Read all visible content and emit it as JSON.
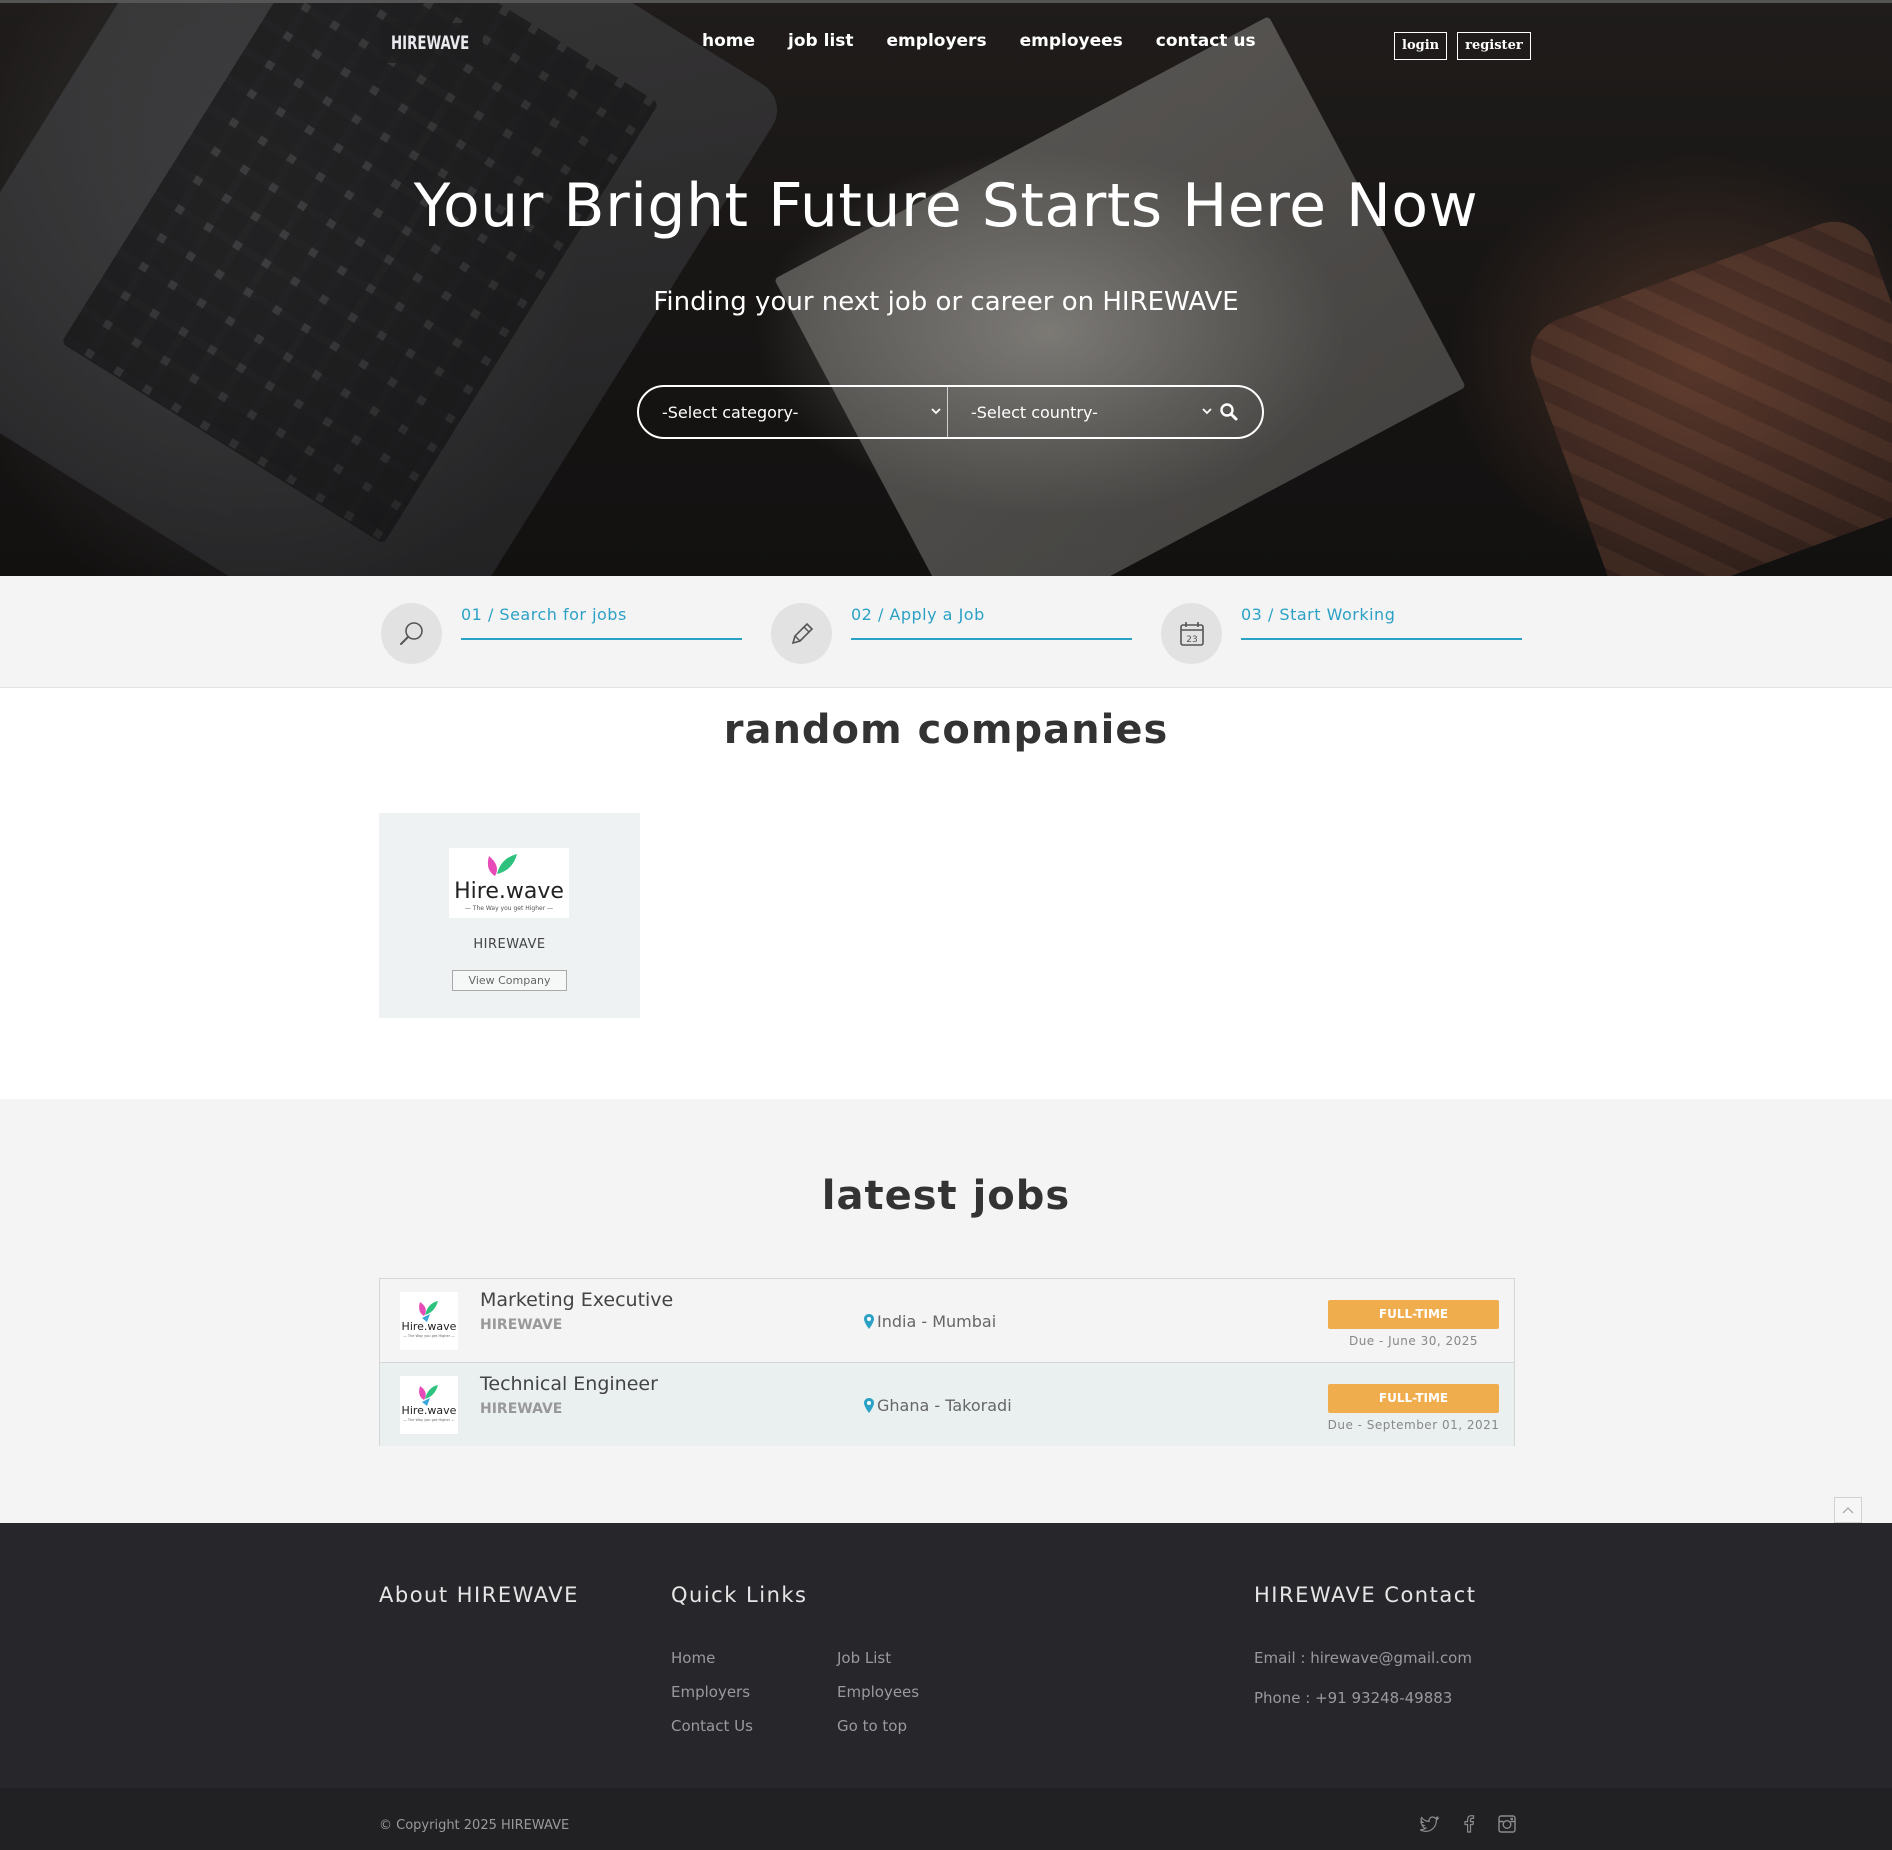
{
  "brand": {
    "logo_text": "HIREWAVE"
  },
  "nav": {
    "items": [
      {
        "label": "home"
      },
      {
        "label": "job list"
      },
      {
        "label": "employers"
      },
      {
        "label": "employees"
      },
      {
        "label": "contact us"
      }
    ],
    "login_label": "login",
    "register_label": "register"
  },
  "hero": {
    "title": "Your Bright Future Starts Here Now",
    "subtitle": "Finding your next job or career on HIREWAVE",
    "category_select": "-Select category-",
    "country_select": "-Select country-"
  },
  "steps": [
    {
      "label": "01 / Search for jobs",
      "icon": "magnifier-icon"
    },
    {
      "label": "02 / Apply a Job",
      "icon": "pencil-icon"
    },
    {
      "label": "03 / Start Working",
      "icon": "calendar-icon"
    }
  ],
  "companies": {
    "title": "random companies",
    "items": [
      {
        "logo_name": "Hire.wave",
        "logo_tagline": "— The Way you get Higher —",
        "name": "HIREWAVE",
        "button": "View Company"
      }
    ]
  },
  "jobs": {
    "title": "latest jobs",
    "items": [
      {
        "title": "Marketing Executive",
        "company": "HIREWAVE",
        "location": "India - Mumbai",
        "type": "FULL-TIME",
        "due": "Due - June 30, 2025"
      },
      {
        "title": "Technical Engineer",
        "company": "HIREWAVE",
        "location": "Ghana - Takoradi",
        "type": "FULL-TIME",
        "due": "Due - September 01, 2021"
      }
    ]
  },
  "footer": {
    "about_heading": "About HIREWAVE",
    "links_heading": "Quick Links",
    "contact_heading": "HIREWAVE Contact",
    "links": [
      "Home",
      "Job List",
      "Employers",
      "Employees",
      "Contact Us",
      "Go to top"
    ],
    "email": "Email : hirewave@gmail.com",
    "phone": "Phone : +91 93248-49883",
    "copyright": "© Copyright 2025 HIREWAVE",
    "social": [
      "twitter-icon",
      "facebook-icon",
      "instagram-icon"
    ]
  },
  "colors": {
    "accent": "#2ca1c6",
    "badge": "#f0ad4e",
    "footer_bg": "#27272b",
    "logo_pink": "#e84bb8",
    "logo_green": "#2ec27e"
  }
}
